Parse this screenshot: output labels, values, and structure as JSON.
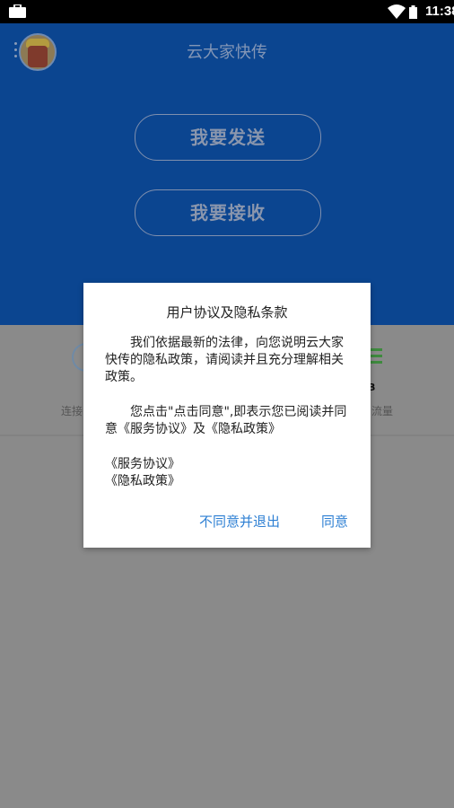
{
  "status_bar": {
    "time": "11:38"
  },
  "app": {
    "title": "云大家快传"
  },
  "main": {
    "send_label": "我要发送",
    "receive_label": "我要接收"
  },
  "lower": {
    "left_label": "连接",
    "right_number": "B",
    "right_label": "流量"
  },
  "dialog": {
    "title": "用户协议及隐私条款",
    "paragraph1": "我们依据最新的法律，向您说明云大家快传的隐私政策，请阅读并且充分理解相关政策。",
    "paragraph2": "您点击\"点击同意\",即表示您已阅读并同意《服务协议》及《隐私政策》",
    "link_service": "《服务协议》",
    "link_privacy": "《隐私政策》",
    "disagree_label": "不同意并退出",
    "agree_label": "同意"
  },
  "colors": {
    "header_bg": "#0b4590",
    "overlay": "#8a8a8a",
    "accent": "#2d7fd3"
  }
}
